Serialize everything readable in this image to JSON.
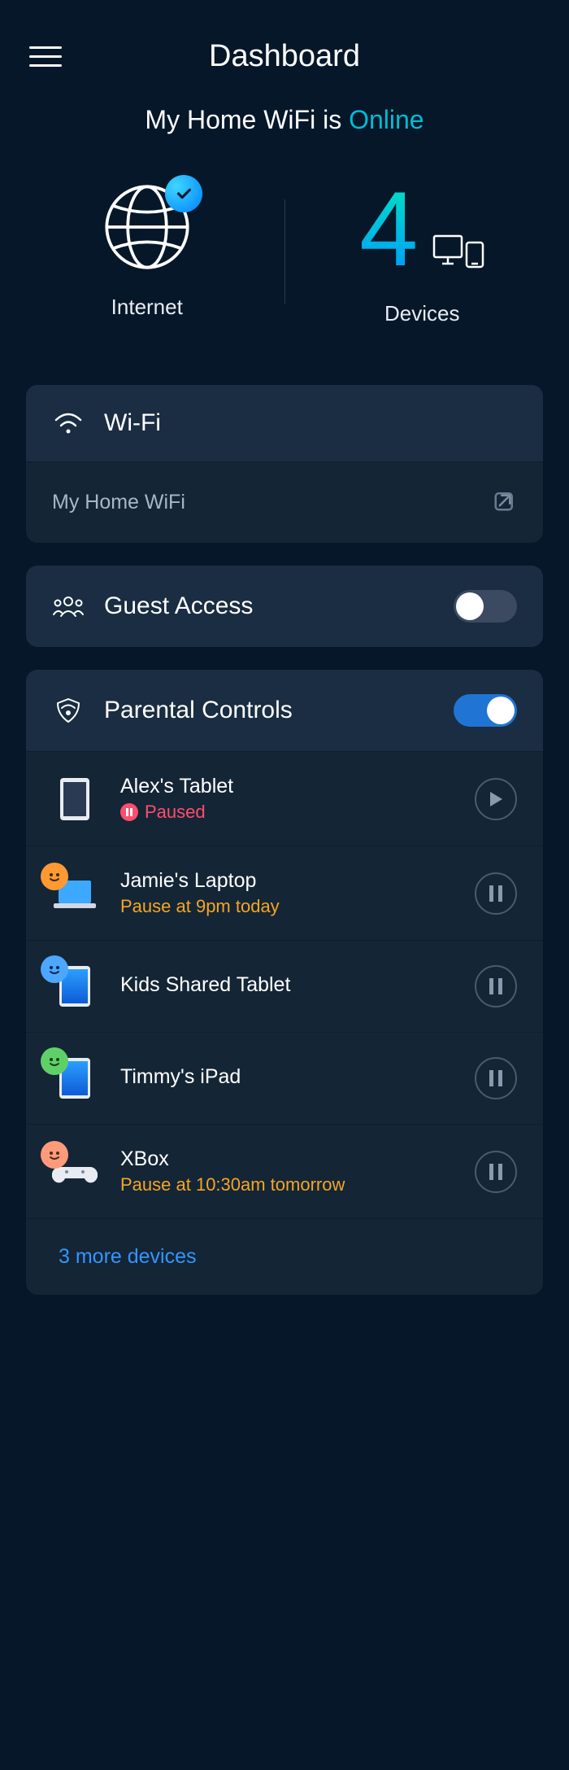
{
  "header": {
    "title": "Dashboard"
  },
  "status": {
    "prefix": "My Home WiFi is ",
    "value": "Online"
  },
  "stats": {
    "internet_label": "Internet",
    "devices_count": "4",
    "devices_label": "Devices"
  },
  "wifi": {
    "section_label": "Wi-Fi",
    "network_name": "My Home WiFi"
  },
  "guest": {
    "section_label": "Guest Access",
    "enabled": false
  },
  "parental": {
    "section_label": "Parental Controls",
    "enabled": true,
    "devices": [
      {
        "name": "Alex's Tablet",
        "status_text": "Paused",
        "status_type": "paused"
      },
      {
        "name": "Jamie's Laptop",
        "status_text": "Pause at 9pm today",
        "status_type": "scheduled"
      },
      {
        "name": "Kids Shared Tablet",
        "status_text": "",
        "status_type": "none"
      },
      {
        "name": "Timmy's iPad",
        "status_text": "",
        "status_type": "none"
      },
      {
        "name": "XBox",
        "status_text": "Pause at 10:30am tomorrow",
        "status_type": "scheduled"
      }
    ],
    "more_link": "3 more devices"
  }
}
